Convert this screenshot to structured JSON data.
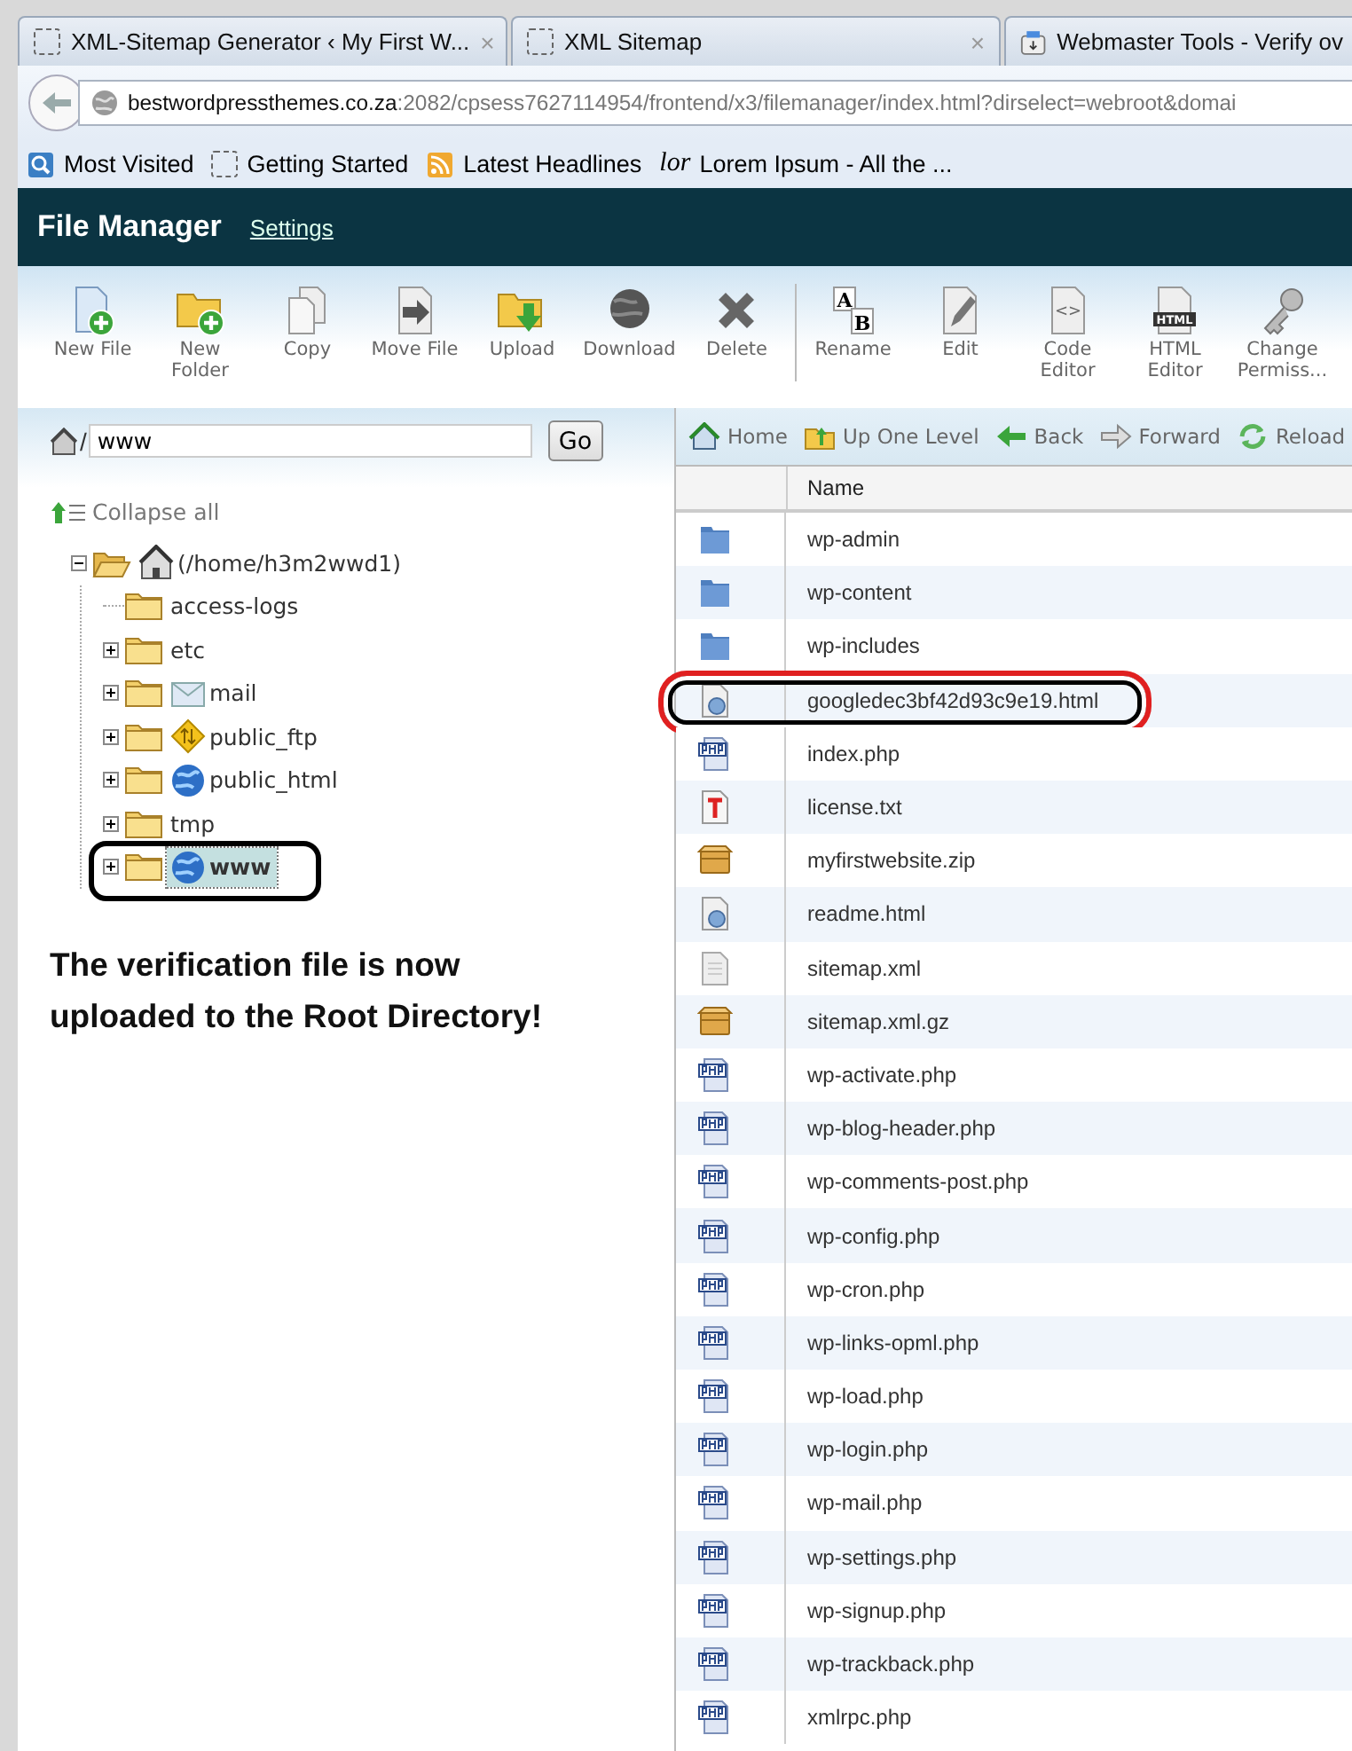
{
  "browser": {
    "tabs": [
      {
        "title": "XML-Sitemap Generator ‹ My First W...",
        "kind": "blank",
        "close": "×",
        "selected": false
      },
      {
        "title": "XML Sitemap",
        "kind": "blank",
        "close": "×",
        "selected": false
      },
      {
        "title": "Webmaster Tools - Verify ov",
        "kind": "webmaster",
        "selected": false
      }
    ],
    "address": {
      "host": "bestwordpressthemes.co.za",
      "rest": ":2082/cpsess7627114954/frontend/x3/filemanager/index.html?dirselect=webroot&domai"
    },
    "bookmarks": [
      {
        "label": "Most Visited",
        "kind": "search"
      },
      {
        "label": "Getting Started",
        "kind": "blank"
      },
      {
        "label": "Latest Headlines",
        "kind": "feed"
      },
      {
        "label": "Lorem Ipsum - All the ...",
        "kind": "lor",
        "icon_text": "lor"
      }
    ]
  },
  "header": {
    "title": "File Manager",
    "link": "Settings"
  },
  "toolbar": {
    "groups": [
      [
        {
          "label": "New File",
          "kind": "new-file"
        },
        {
          "label": "New Folder",
          "kind": "new-folder"
        },
        {
          "label": "Copy",
          "kind": "copy"
        },
        {
          "label": "Move File",
          "kind": "move"
        },
        {
          "label": "Upload",
          "kind": "upload"
        },
        {
          "label": "Download",
          "kind": "download"
        },
        {
          "label": "Delete",
          "kind": "delete"
        }
      ],
      [
        {
          "label": "Rename",
          "kind": "rename",
          "icon_text": [
            "A",
            "B"
          ]
        },
        {
          "label": "Edit",
          "kind": "edit"
        },
        {
          "label": "Code Editor",
          "kind": "code",
          "icon_text": "<>"
        },
        {
          "label": "HTML Editor",
          "kind": "html",
          "icon_text": "HTML"
        },
        {
          "label": "Change Permiss...",
          "kind": "key"
        }
      ]
    ]
  },
  "path_field": {
    "value": "www",
    "separator": "/",
    "button": "Go"
  },
  "collapse_all": "Collapse all",
  "tree": {
    "root": {
      "label": "(/home/h3m2wwd1)",
      "kind": "home",
      "has_children": true,
      "expanded": true,
      "selected": false,
      "circled": false,
      "children": [
        {
          "label": "access-logs",
          "kind": "plain",
          "has_children": false,
          "selected": false,
          "circled": false
        },
        {
          "label": "etc",
          "kind": "plain",
          "has_children": true,
          "expanded": false,
          "selected": false,
          "circled": false
        },
        {
          "label": "mail",
          "kind": "mail",
          "has_children": true,
          "expanded": false,
          "selected": false,
          "circled": false
        },
        {
          "label": "public_ftp",
          "kind": "ftp",
          "has_children": true,
          "expanded": false,
          "selected": false,
          "circled": false
        },
        {
          "label": "public_html",
          "kind": "web",
          "has_children": true,
          "expanded": false,
          "selected": false,
          "circled": false
        },
        {
          "label": "tmp",
          "kind": "plain",
          "has_children": true,
          "expanded": false,
          "selected": false,
          "circled": false
        },
        {
          "label": "www",
          "kind": "web",
          "has_children": true,
          "expanded": false,
          "selected": true,
          "circled": true
        }
      ]
    }
  },
  "annotation": "The verification file is now uploaded to the Root Directory!",
  "nav": [
    {
      "label": "Home",
      "kind": "home"
    },
    {
      "label": "Up One Level",
      "kind": "up"
    },
    {
      "label": "Back",
      "kind": "back"
    },
    {
      "label": "Forward",
      "kind": "forward"
    },
    {
      "label": "Reload",
      "kind": "reload"
    }
  ],
  "files": {
    "columns": [
      "Name"
    ],
    "rows": [
      {
        "name": "wp-admin",
        "kind": "folder",
        "circled": false
      },
      {
        "name": "wp-content",
        "kind": "folder",
        "circled": false
      },
      {
        "name": "wp-includes",
        "kind": "folder",
        "circled": false
      },
      {
        "name": "googledec3bf42d93c9e19.html",
        "kind": "html",
        "circled": true
      },
      {
        "name": "index.php",
        "kind": "php",
        "circled": false
      },
      {
        "name": "license.txt",
        "kind": "text",
        "circled": false
      },
      {
        "name": "myfirstwebsite.zip",
        "kind": "archive",
        "circled": false
      },
      {
        "name": "readme.html",
        "kind": "html",
        "circled": false
      },
      {
        "name": "sitemap.xml",
        "kind": "xml",
        "circled": false
      },
      {
        "name": "sitemap.xml.gz",
        "kind": "archive",
        "circled": false
      },
      {
        "name": "wp-activate.php",
        "kind": "php",
        "circled": false
      },
      {
        "name": "wp-blog-header.php",
        "kind": "php",
        "circled": false
      },
      {
        "name": "wp-comments-post.php",
        "kind": "php",
        "circled": false
      },
      {
        "name": "wp-config.php",
        "kind": "php",
        "circled": false
      },
      {
        "name": "wp-cron.php",
        "kind": "php",
        "circled": false
      },
      {
        "name": "wp-links-opml.php",
        "kind": "php",
        "circled": false
      },
      {
        "name": "wp-load.php",
        "kind": "php",
        "circled": false
      },
      {
        "name": "wp-login.php",
        "kind": "php",
        "circled": false
      },
      {
        "name": "wp-mail.php",
        "kind": "php",
        "circled": false
      },
      {
        "name": "wp-settings.php",
        "kind": "php",
        "circled": false
      },
      {
        "name": "wp-signup.php",
        "kind": "php",
        "circled": false
      },
      {
        "name": "wp-trackback.php",
        "kind": "php",
        "circled": false
      },
      {
        "name": "xmlrpc.php",
        "kind": "php",
        "circled": false
      }
    ]
  }
}
